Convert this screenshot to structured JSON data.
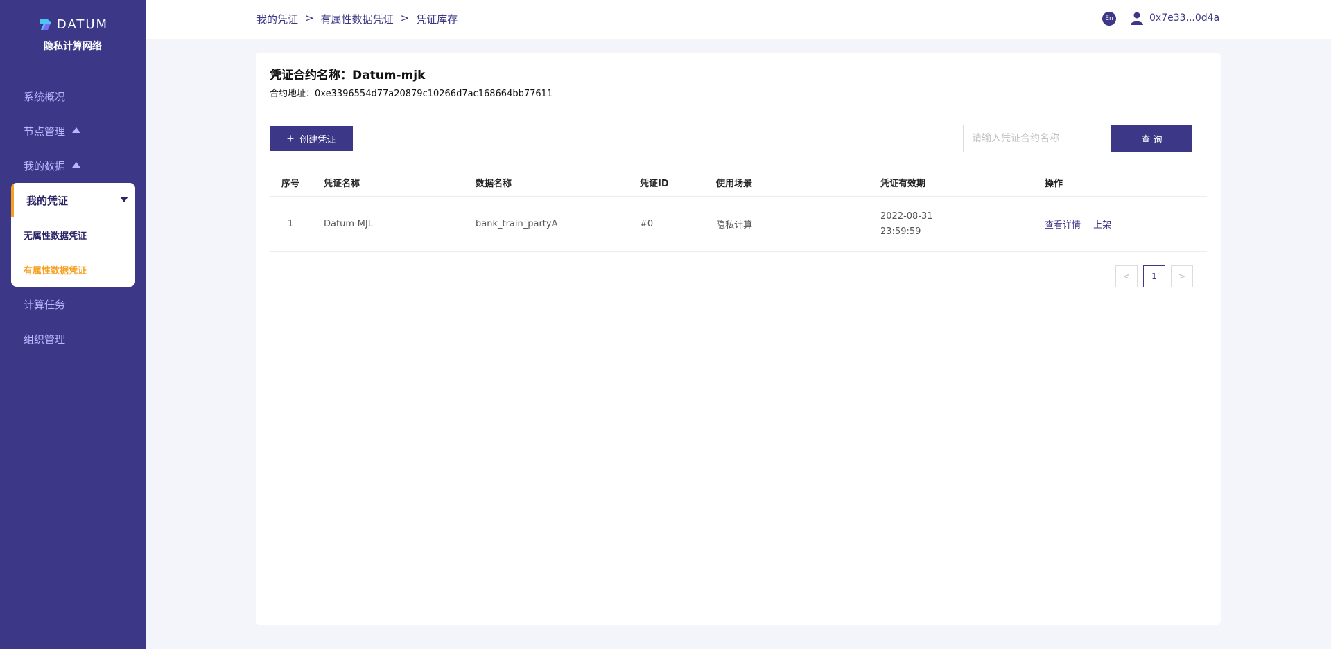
{
  "brand": {
    "logo_text": "DATUM",
    "subtitle": "隐私计算网络"
  },
  "sidebar": {
    "items": [
      {
        "label": "系统概况"
      },
      {
        "label": "节点管理"
      },
      {
        "label": "我的数据"
      }
    ],
    "submenu": {
      "title": "我的凭证",
      "items": [
        {
          "label": "无属性数据凭证"
        },
        {
          "label": "有属性数据凭证"
        }
      ]
    },
    "lower_items": [
      {
        "label": "计算任务"
      },
      {
        "label": "组织管理"
      }
    ]
  },
  "header": {
    "breadcrumb": [
      "我的凭证",
      "有属性数据凭证",
      "凭证库存"
    ],
    "separator": ">",
    "lang": "En",
    "user": "0x7e33...0d4a"
  },
  "main": {
    "contract_name": "凭证合约名称：Datum-mjk",
    "contract_address": "合约地址：0xe3396554d77a20879c10266d7ac168664bb77611",
    "create_label": "创建凭证",
    "search_placeholder": "请输入凭证合约名称",
    "search_label": "查 询",
    "columns": [
      "序号",
      "凭证名称",
      "数据名称",
      "凭证ID",
      "使用场景",
      "凭证有效期",
      "操作"
    ],
    "rows": [
      {
        "index": "1",
        "name": "Datum-MJL",
        "data_name": "bank_train_partyA",
        "id": "#0",
        "scenario": "隐私计算",
        "validity_date": "2022-08-31",
        "validity_time": "23:59:59",
        "actions": [
          "查看详情",
          "上架"
        ]
      }
    ],
    "pagination": {
      "prev": "<",
      "current": "1",
      "next": ">"
    }
  },
  "colors": {
    "primary": "#3c3786",
    "accent": "#f7a120",
    "sidebar_text": "#b8b7ff"
  }
}
